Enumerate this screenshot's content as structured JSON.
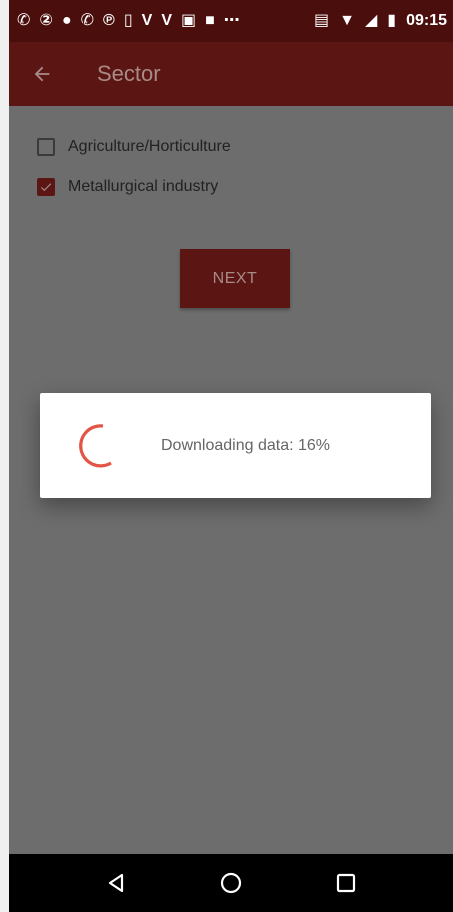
{
  "status_bar": {
    "left_icons": [
      "call-missed-icon",
      "whatsapp-icon",
      "messenger-icon",
      "call-missed-icon",
      "pinterest-icon",
      "sim-icon",
      "viber-icon",
      "viber-icon",
      "photo-icon",
      "video-icon",
      "more-icon"
    ],
    "right_icons": [
      "cast-icon",
      "wifi-icon",
      "signal-icon",
      "battery-charging-icon"
    ],
    "time": "09:15"
  },
  "app_bar": {
    "title": "Sector",
    "back_icon": "arrow-back-icon"
  },
  "sectors": [
    {
      "label": "Agriculture/Horticulture",
      "checked": false
    },
    {
      "label": "Metallurgical industry",
      "checked": true
    }
  ],
  "next_button": {
    "label": "NEXT"
  },
  "dialog": {
    "message": "Downloading data: 16%",
    "progress": 16
  },
  "nav_bar": {
    "buttons": [
      "back-triangle-icon",
      "home-circle-icon",
      "recents-square-icon"
    ]
  },
  "colors": {
    "primary": "#5b1512",
    "status_bar": "#4a0f0c",
    "scrim_background": "#6d6d6d",
    "spinner": "#e35445"
  }
}
